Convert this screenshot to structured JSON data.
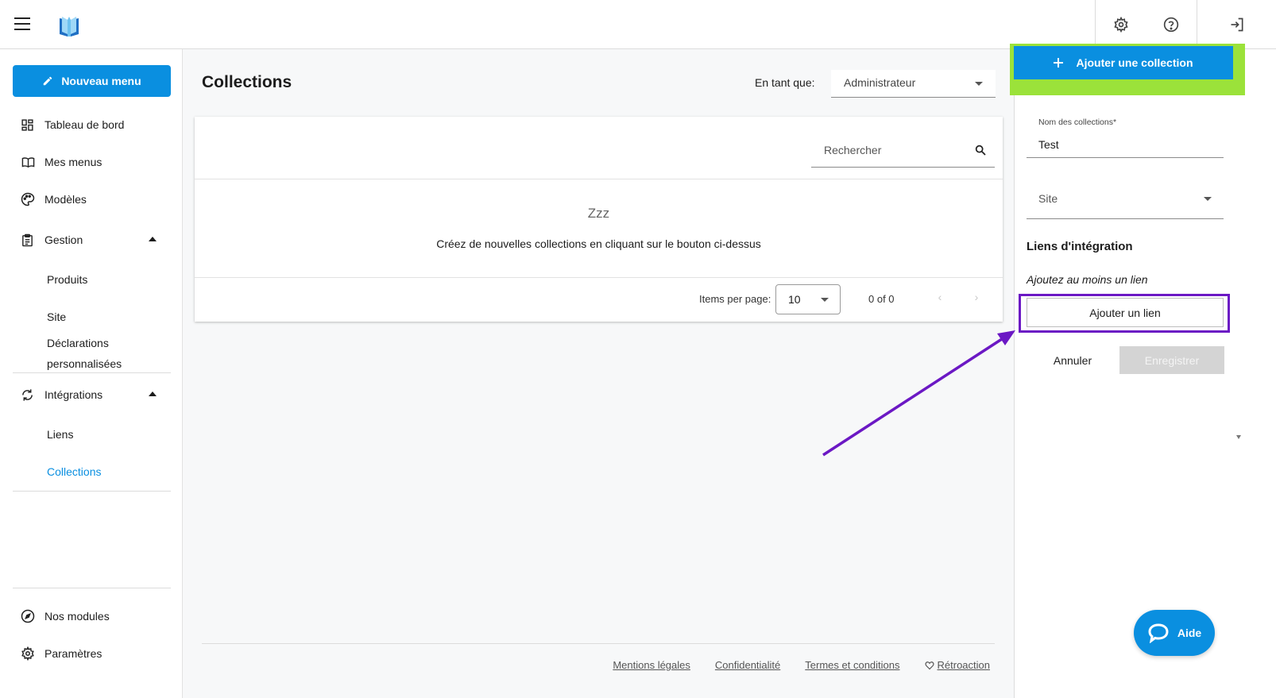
{
  "header": {
    "menu_icon": "hamburger-icon",
    "logo_icon": "book-logo-icon",
    "actions": [
      {
        "icon": "gear-icon"
      },
      {
        "icon": "help-circle-icon"
      },
      {
        "icon": "logout-icon"
      }
    ]
  },
  "sidebar": {
    "new_menu_label": "Nouveau menu",
    "items": [
      {
        "label": "Tableau de bord",
        "icon": "dashboard-icon"
      },
      {
        "label": "Mes menus",
        "icon": "open-book-icon"
      },
      {
        "label": "Modèles",
        "icon": "palette-icon"
      },
      {
        "label": "Gestion",
        "icon": "clipboard-icon",
        "expanded": true
      },
      {
        "label": "Intégrations",
        "icon": "sync-icon",
        "expanded": true
      }
    ],
    "gestion_sub": [
      "Produits",
      "Site",
      "Déclarations",
      "personnalisées"
    ],
    "integrations_sub": [
      "Liens",
      "Collections"
    ],
    "bottom": [
      {
        "label": "Nos modules",
        "icon": "compass-icon"
      },
      {
        "label": "Paramètres",
        "icon": "gear-icon"
      }
    ]
  },
  "main": {
    "title": "Collections",
    "role_label": "En tant que:",
    "role_value": "Administrateur",
    "search_placeholder": "Rechercher",
    "empty_title": "Zzz",
    "empty_message": "Créez de nouvelles collections en cliquant sur le bouton ci-dessus",
    "items_per_page_label": "Items per page:",
    "items_per_page_value": "10",
    "range": "0 of 0",
    "prev": "‹",
    "next": "›"
  },
  "footer": {
    "links": [
      "Mentions légales",
      "Confidentialité",
      "Termes et conditions",
      "Rétroaction"
    ]
  },
  "panel": {
    "add_collection_label": "Ajouter une collection",
    "name_label": "Nom des collections*",
    "name_value": "Test",
    "site_placeholder": "Site",
    "section_title": "Liens d'intégration",
    "hint": "Ajoutez au moins un lien",
    "add_link_label": "Ajouter un lien",
    "cancel_label": "Annuler",
    "save_label": "Enregistrer"
  },
  "help": {
    "label": "Aide",
    "icon": "chat-bubble-icon"
  },
  "colors": {
    "accent": "#0a8fe0",
    "highlight_green": "#9be23a",
    "highlight_purple": "#6b18c4"
  }
}
